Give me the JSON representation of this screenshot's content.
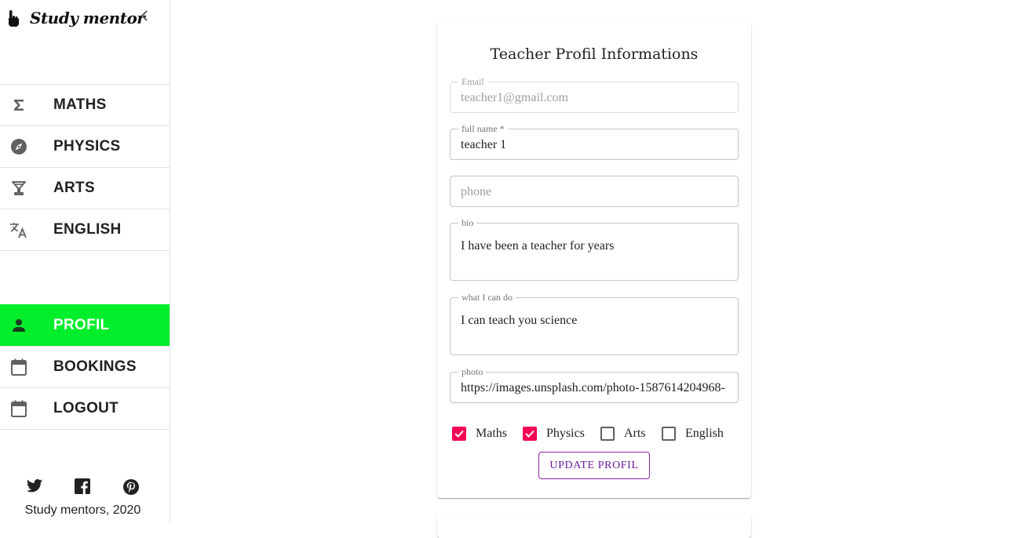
{
  "brand": {
    "title": "Study mentor",
    "icon": "hand-pointer-icon"
  },
  "sidebar": {
    "subjects": [
      {
        "label": "MATHS",
        "icon": "sigma-icon"
      },
      {
        "label": "PHYSICS",
        "icon": "compass-icon"
      },
      {
        "label": "ARTS",
        "icon": "cocktail-glass-icon"
      },
      {
        "label": "ENGLISH",
        "icon": "translate-icon"
      }
    ],
    "account": [
      {
        "label": "PROFIL",
        "icon": "person-icon",
        "active": true
      },
      {
        "label": "BOOKINGS",
        "icon": "calendar-icon"
      },
      {
        "label": "LOGOUT",
        "icon": "calendar-icon"
      }
    ],
    "active_color": "#00ee2b",
    "social": [
      "twitter-icon",
      "facebook-icon",
      "pinterest-icon"
    ],
    "footer": "Study mentors, 2020"
  },
  "form": {
    "title": "Teacher Profil Informations",
    "email": {
      "label": "Email",
      "value": "teacher1@gmail.com"
    },
    "full_name": {
      "label": "full name *",
      "value": "teacher 1"
    },
    "phone": {
      "placeholder": "phone"
    },
    "bio": {
      "label": "bio",
      "value": "I have been a teacher for years"
    },
    "what_i_can_do": {
      "label": "what I can do",
      "value": "I can teach you science"
    },
    "photo": {
      "label": "photo",
      "value": "https://images.unsplash.com/photo-1587614204968-"
    },
    "subjects": [
      {
        "label": "Maths",
        "checked": true
      },
      {
        "label": "Physics",
        "checked": true
      },
      {
        "label": "Arts",
        "checked": false
      },
      {
        "label": "English",
        "checked": false
      }
    ],
    "checkbox_color": "#f50057",
    "update_button": "UPDATE PROFIL"
  }
}
